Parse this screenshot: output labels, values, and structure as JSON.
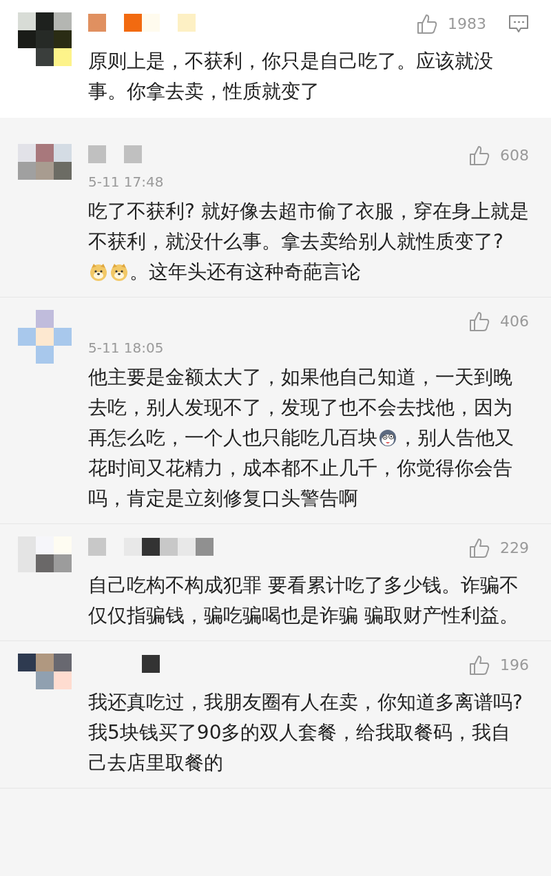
{
  "comments": [
    {
      "likes": "1983",
      "reply_icon": true,
      "body": [
        {
          "kind": "text",
          "text": "原则上是，不获利，你只是自己吃了。应该就没事。你拿去卖，性质就变了"
        }
      ]
    },
    {
      "likes": "608",
      "reply_icon": false,
      "time": "5-11 17:48",
      "body": [
        {
          "kind": "text",
          "text": "吃了不获利? 就好像去超市偷了衣服，穿在身上就是不获利，就没什么事。拿去卖给别人就性质变了? "
        },
        {
          "kind": "doge"
        },
        {
          "kind": "doge"
        },
        {
          "kind": "text",
          "text": "。这年头还有这种奇葩言论"
        }
      ]
    },
    {
      "likes": "406",
      "reply_icon": false,
      "time": "5-11 18:05",
      "body": [
        {
          "kind": "text",
          "text": "他主要是金额太大了，如果他自己知道，一天到晚去吃，别人发现不了，发现了也不会去找他，因为再怎么吃，一个人也只能吃几百块"
        },
        {
          "kind": "crazy"
        },
        {
          "kind": "text",
          "text": "，别人告他又花时间又花精力，成本都不止几千，你觉得你会告吗，肯定是立刻修复口头警告啊"
        }
      ]
    },
    {
      "likes": "229",
      "reply_icon": false,
      "body": [
        {
          "kind": "text",
          "text": "自己吃构不构成犯罪 要看累计吃了多少钱。诈骗不仅仅指骗钱，骗吃骗喝也是诈骗 骗取财产性利益。"
        }
      ]
    },
    {
      "likes": "196",
      "reply_icon": false,
      "body": [
        {
          "kind": "text",
          "text": "我还真吃过，我朋友圈有人在卖，你知道多离谱吗? 我5块钱买了90多的双人套餐，给我取餐码，我自己去店里取餐的"
        }
      ]
    }
  ]
}
